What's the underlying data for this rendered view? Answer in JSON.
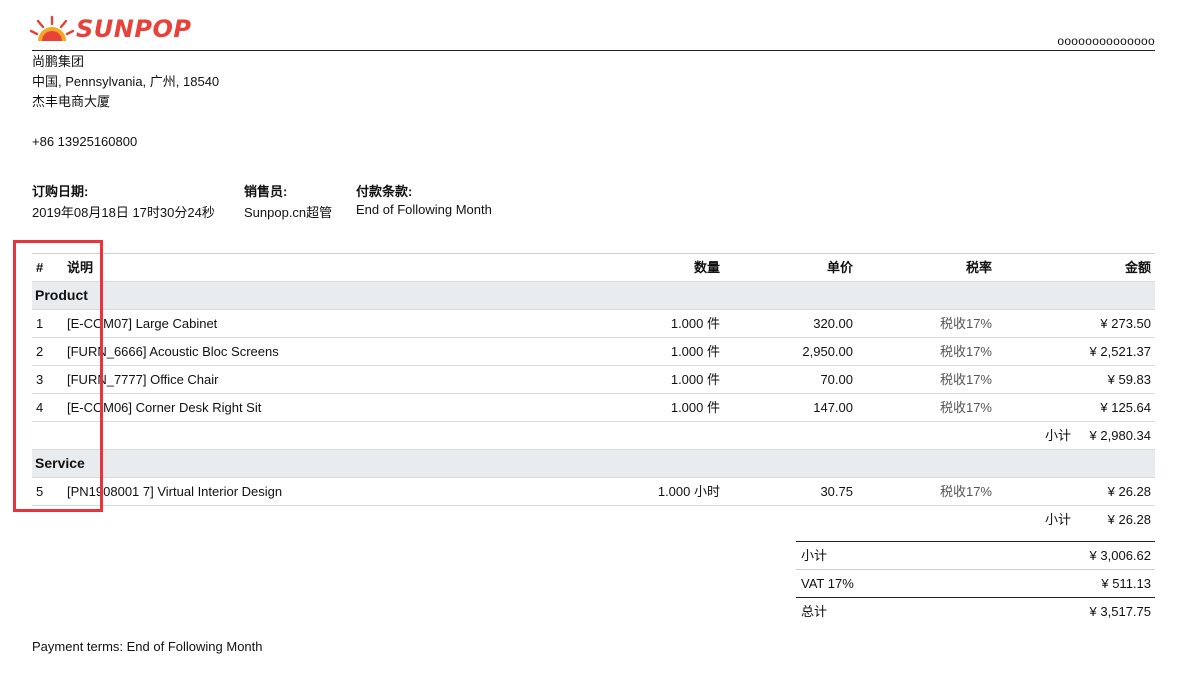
{
  "brand": {
    "name": "SUNPOP",
    "color": "#e8413a"
  },
  "reference": "oooooooooooooo",
  "company": {
    "name": "尚鹏集团",
    "address_line": "中国, Pennsylvania, 广州, 18540",
    "building": "杰丰电商大厦",
    "phone": "+86 13925160800"
  },
  "info": {
    "order_date_label": "订购日期:",
    "order_date": "2019年08月18日 17时30分24秒",
    "salesperson_label": "销售员:",
    "salesperson": "Sunpop.cn超管",
    "payment_terms_label": "付款条款:",
    "payment_terms": "End of Following Month"
  },
  "table": {
    "headers": {
      "num": "#",
      "desc": "说明",
      "qty": "数量",
      "price": "单价",
      "tax": "税率",
      "amount": "金额"
    },
    "sections": [
      {
        "name": "Product",
        "rows": [
          {
            "num": "1",
            "desc": "[E-COM07] Large Cabinet",
            "qty": "1.000 件",
            "price": "320.00",
            "tax": "税收17%",
            "amount": "¥ 273.50"
          },
          {
            "num": "2",
            "desc": "[FURN_6666] Acoustic Bloc Screens",
            "qty": "1.000 件",
            "price": "2,950.00",
            "tax": "税收17%",
            "amount": "¥ 2,521.37"
          },
          {
            "num": "3",
            "desc": "[FURN_7777] Office Chair",
            "qty": "1.000 件",
            "price": "70.00",
            "tax": "税收17%",
            "amount": "¥ 59.83"
          },
          {
            "num": "4",
            "desc": "[E-COM06] Corner Desk Right Sit",
            "qty": "1.000 件",
            "price": "147.00",
            "tax": "税收17%",
            "amount": "¥ 125.64"
          }
        ],
        "subtotal_label": "小计",
        "subtotal": "¥ 2,980.34"
      },
      {
        "name": "Service",
        "rows": [
          {
            "num": "5",
            "desc": "[PN1908001 7] Virtual Interior Design",
            "qty": "1.000 小时",
            "price": "30.75",
            "tax": "税收17%",
            "amount": "¥ 26.28"
          }
        ],
        "subtotal_label": "小计",
        "subtotal": "¥ 26.28"
      }
    ]
  },
  "totals": {
    "subtotal_label": "小计",
    "subtotal": "¥ 3,006.62",
    "vat_label": "VAT 17%",
    "vat": "¥ 511.13",
    "total_label": "总计",
    "total": "¥ 3,517.75"
  },
  "footer": {
    "payment_note": "Payment terms: End of Following Month"
  },
  "annotation": {
    "highlight_color": "#e8343a"
  }
}
